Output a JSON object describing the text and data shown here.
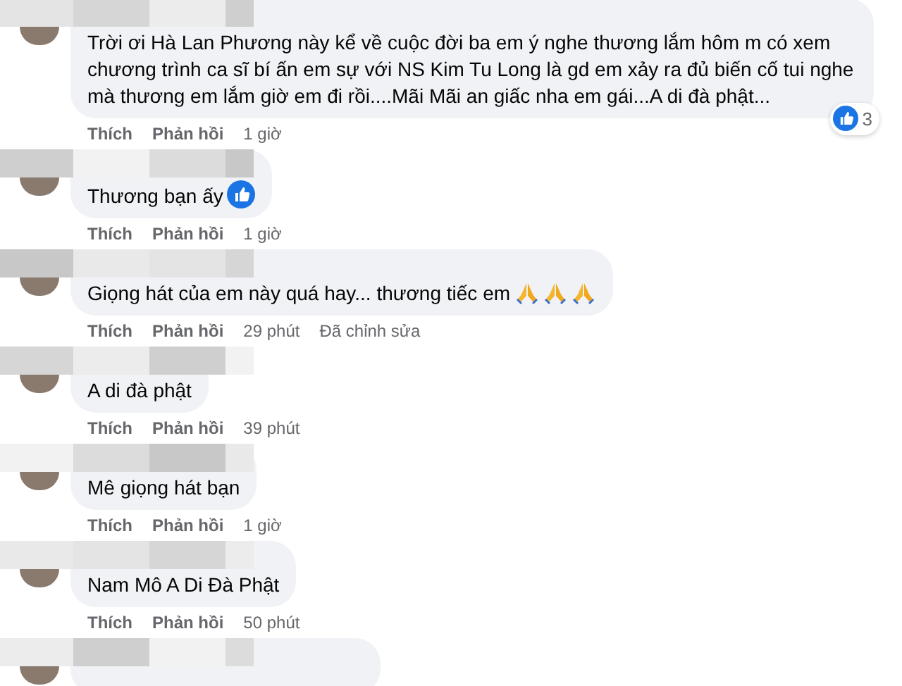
{
  "comments": [
    {
      "kind": "full",
      "text": "Trời ơi Hà Lan Phương này kể về cuộc đời ba em ý nghe thương lắm hôm m có xem chương trình ca sĩ bí ấn em sự với NS Kim Tu Long là gd em xảy ra đủ biến cố tui nghe mà thương em lắm giờ em đi rồi....Mãi Mãi an giấc nha em gái...A di đà phật...",
      "reactions": {
        "count": "3"
      },
      "actions": [
        "Thích",
        "Phản hồi"
      ],
      "time": "1 giờ"
    },
    {
      "kind": "full",
      "text": "Thương bạn ấy",
      "inline_icons": [
        {
          "kind": "like"
        }
      ],
      "actions": [
        "Thích",
        "Phản hồi"
      ],
      "time": "1 giờ"
    },
    {
      "kind": "full",
      "text": "Giọng hát của em này quá hay... thương tiếc em",
      "inline_icons": [
        {
          "kind": "pray"
        },
        {
          "kind": "pray"
        },
        {
          "kind": "pray"
        }
      ],
      "actions": [
        "Thích",
        "Phản hồi"
      ],
      "time": "29 phút",
      "edited": "Đã chỉnh sửa"
    },
    {
      "kind": "full",
      "text": "A di đà phật",
      "actions": [
        "Thích",
        "Phản hồi"
      ],
      "time": "39 phút"
    },
    {
      "kind": "full",
      "text": "Mê giọng hát bạn",
      "actions": [
        "Thích",
        "Phản hồi"
      ],
      "time": "1 giờ"
    },
    {
      "kind": "full",
      "text": "Nam Mô A Di Đà Phật",
      "actions": [
        "Thích",
        "Phản hồi"
      ],
      "time": "50 phút"
    },
    {
      "kind": "partial"
    }
  ]
}
